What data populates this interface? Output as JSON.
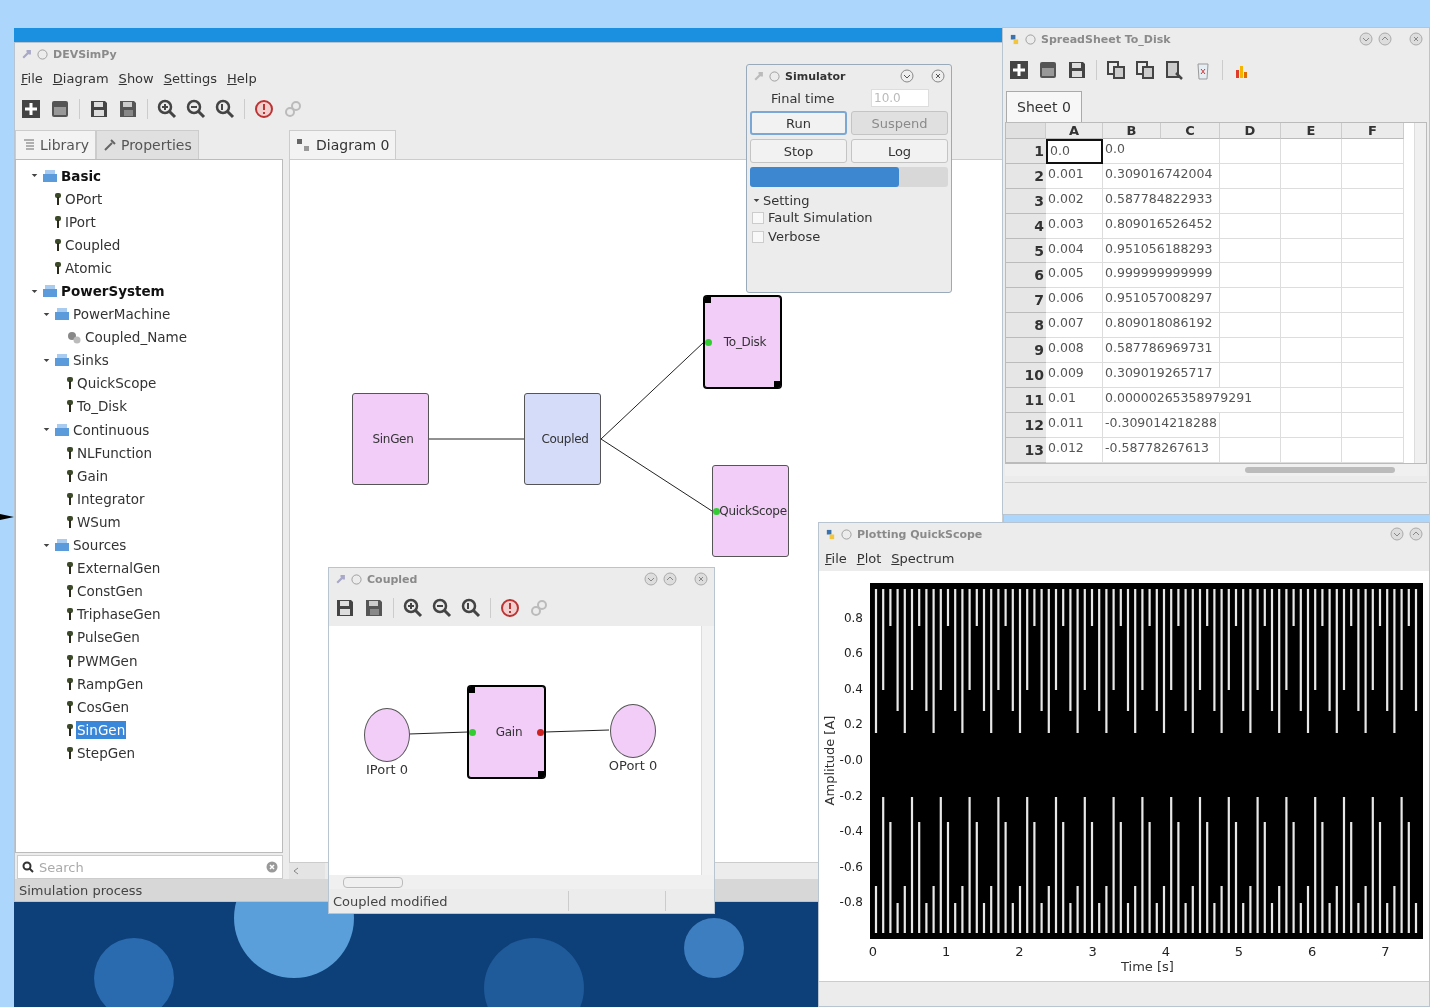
{
  "main_window": {
    "title": "DEVSimPy",
    "menu": [
      "File",
      "Diagram",
      "Show",
      "Settings",
      "Help"
    ],
    "panel_tabs": [
      {
        "label": "Library",
        "selected": true
      },
      {
        "label": "Properties",
        "selected": false
      }
    ],
    "library_tree": [
      {
        "label": "Basic",
        "kind": "library",
        "expanded": true,
        "children": [
          {
            "label": "OPort",
            "kind": "model",
            "selected": false
          },
          {
            "label": "IPort",
            "kind": "model",
            "selected": false
          },
          {
            "label": "Coupled",
            "kind": "model",
            "selected": false
          },
          {
            "label": "Atomic",
            "kind": "model",
            "selected": false
          }
        ]
      },
      {
        "label": "PowerSystem",
        "kind": "library",
        "expanded": true,
        "children": [
          {
            "label": "PowerMachine",
            "kind": "folder",
            "expanded": true,
            "children": [
              {
                "label": "Coupled_Name",
                "kind": "coupled",
                "selected": false
              }
            ]
          },
          {
            "label": "Sinks",
            "kind": "folder",
            "expanded": true,
            "children": [
              {
                "label": "QuickScope",
                "kind": "model",
                "selected": false
              },
              {
                "label": "To_Disk",
                "kind": "model",
                "selected": false
              }
            ]
          },
          {
            "label": "Continuous",
            "kind": "folder",
            "expanded": true,
            "children": [
              {
                "label": "NLFunction",
                "kind": "model",
                "selected": false
              },
              {
                "label": "Gain",
                "kind": "model",
                "selected": false
              },
              {
                "label": "Integrator",
                "kind": "model",
                "selected": false
              },
              {
                "label": "WSum",
                "kind": "model",
                "selected": false
              }
            ]
          },
          {
            "label": "Sources",
            "kind": "folder",
            "expanded": true,
            "children": [
              {
                "label": "ExternalGen",
                "kind": "model",
                "selected": false
              },
              {
                "label": "ConstGen",
                "kind": "model",
                "selected": false
              },
              {
                "label": "TriphaseGen",
                "kind": "model",
                "selected": false
              },
              {
                "label": "PulseGen",
                "kind": "model",
                "selected": false
              },
              {
                "label": "PWMGen",
                "kind": "model",
                "selected": false
              },
              {
                "label": "RampGen",
                "kind": "model",
                "selected": false
              },
              {
                "label": "CosGen",
                "kind": "model",
                "selected": false
              },
              {
                "label": "SinGen",
                "kind": "model",
                "selected": true
              },
              {
                "label": "StepGen",
                "kind": "model",
                "selected": false
              }
            ]
          }
        ]
      }
    ],
    "search": {
      "placeholder": "Search"
    },
    "diagram_tabs": [
      {
        "label": "Diagram 0",
        "selected": true
      }
    ],
    "diagram_nodes": [
      {
        "label": "SinGen",
        "kind": "atomic",
        "selected": false
      },
      {
        "label": "Coupled",
        "kind": "coupled",
        "selected": false
      },
      {
        "label": "To_Disk",
        "kind": "atomic",
        "selected": true
      },
      {
        "label": "QuickScope",
        "kind": "atomic",
        "selected": false
      }
    ],
    "status_bar": "Simulation process"
  },
  "coupled_window": {
    "title": "Coupled",
    "nodes": [
      {
        "label": "IPort 0",
        "kind": "iport",
        "selected": false
      },
      {
        "label": "Gain",
        "kind": "block",
        "selected": true
      },
      {
        "label": "OPort 0",
        "kind": "oport",
        "selected": false
      }
    ],
    "status_bar": "Coupled modified"
  },
  "simulator": {
    "title": "Simulator",
    "final_time_label": "Final time",
    "final_time": "10.0",
    "buttons": [
      {
        "label": "Run",
        "disabled": false
      },
      {
        "label": "Suspend",
        "disabled": true
      },
      {
        "label": "Stop",
        "disabled": false
      },
      {
        "label": "Log",
        "disabled": false
      }
    ],
    "progress": {
      "level": 0.75
    },
    "setting": {
      "label": "Setting",
      "expanded": true
    },
    "options": [
      {
        "label": "Fault Simulation",
        "checked": false
      },
      {
        "label": "Verbose",
        "checked": false
      }
    ]
  },
  "spreadsheet": {
    "title": "SpreadSheet To_Disk",
    "sheet_tabs": [
      {
        "label": "Sheet 0",
        "selected": true
      }
    ],
    "columns": [
      "A",
      "B",
      "C",
      "D",
      "E",
      "F"
    ],
    "rows": [
      {
        "number": "1",
        "cells": [
          {
            "text": "0.0",
            "selected": true
          },
          {
            "text": "0.0",
            "selected": false
          }
        ]
      },
      {
        "number": "2",
        "cells": [
          {
            "text": "0.001",
            "selected": false
          },
          {
            "text": "0.309016742004",
            "selected": false
          }
        ]
      },
      {
        "number": "3",
        "cells": [
          {
            "text": "0.002",
            "selected": false
          },
          {
            "text": "0.587784822933",
            "selected": false
          }
        ]
      },
      {
        "number": "4",
        "cells": [
          {
            "text": "0.003",
            "selected": false
          },
          {
            "text": "0.809016526452",
            "selected": false
          }
        ]
      },
      {
        "number": "5",
        "cells": [
          {
            "text": "0.004",
            "selected": false
          },
          {
            "text": "0.951056188293",
            "selected": false
          }
        ]
      },
      {
        "number": "6",
        "cells": [
          {
            "text": "0.005",
            "selected": false
          },
          {
            "text": "0.999999999999",
            "selected": false
          }
        ]
      },
      {
        "number": "7",
        "cells": [
          {
            "text": "0.006",
            "selected": false
          },
          {
            "text": "0.951057008297",
            "selected": false
          }
        ]
      },
      {
        "number": "8",
        "cells": [
          {
            "text": "0.007",
            "selected": false
          },
          {
            "text": "0.809018086192",
            "selected": false
          }
        ]
      },
      {
        "number": "9",
        "cells": [
          {
            "text": "0.008",
            "selected": false
          },
          {
            "text": "0.587786969731",
            "selected": false
          }
        ]
      },
      {
        "number": "10",
        "cells": [
          {
            "text": "0.009",
            "selected": false
          },
          {
            "text": "0.309019265717",
            "selected": false
          }
        ]
      },
      {
        "number": "11",
        "cells": [
          {
            "text": "0.01",
            "selected": false
          },
          {
            "text": "0.00000265358979291",
            "selected": false
          }
        ]
      },
      {
        "number": "12",
        "cells": [
          {
            "text": "0.011",
            "selected": false
          },
          {
            "text": "-0.309014218288",
            "selected": false
          }
        ]
      },
      {
        "number": "13",
        "cells": [
          {
            "text": "0.012",
            "selected": false
          },
          {
            "text": "-0.58778267613",
            "selected": false
          }
        ]
      }
    ]
  },
  "plot_window": {
    "title": "Plotting QuickScope",
    "menu": [
      "File",
      "Plot",
      "Spectrum"
    ],
    "ylabel": "Amplitude [A]",
    "xlabel": "Time [s]",
    "ytick_labels": [
      "0.8",
      "0.6",
      "0.4",
      "0.2",
      "-0.0",
      "-0.2",
      "-0.4",
      "-0.6",
      "-0.8"
    ],
    "xtick_labels": [
      "0",
      "1",
      "2",
      "3",
      "4",
      "5",
      "6",
      "7"
    ]
  }
}
